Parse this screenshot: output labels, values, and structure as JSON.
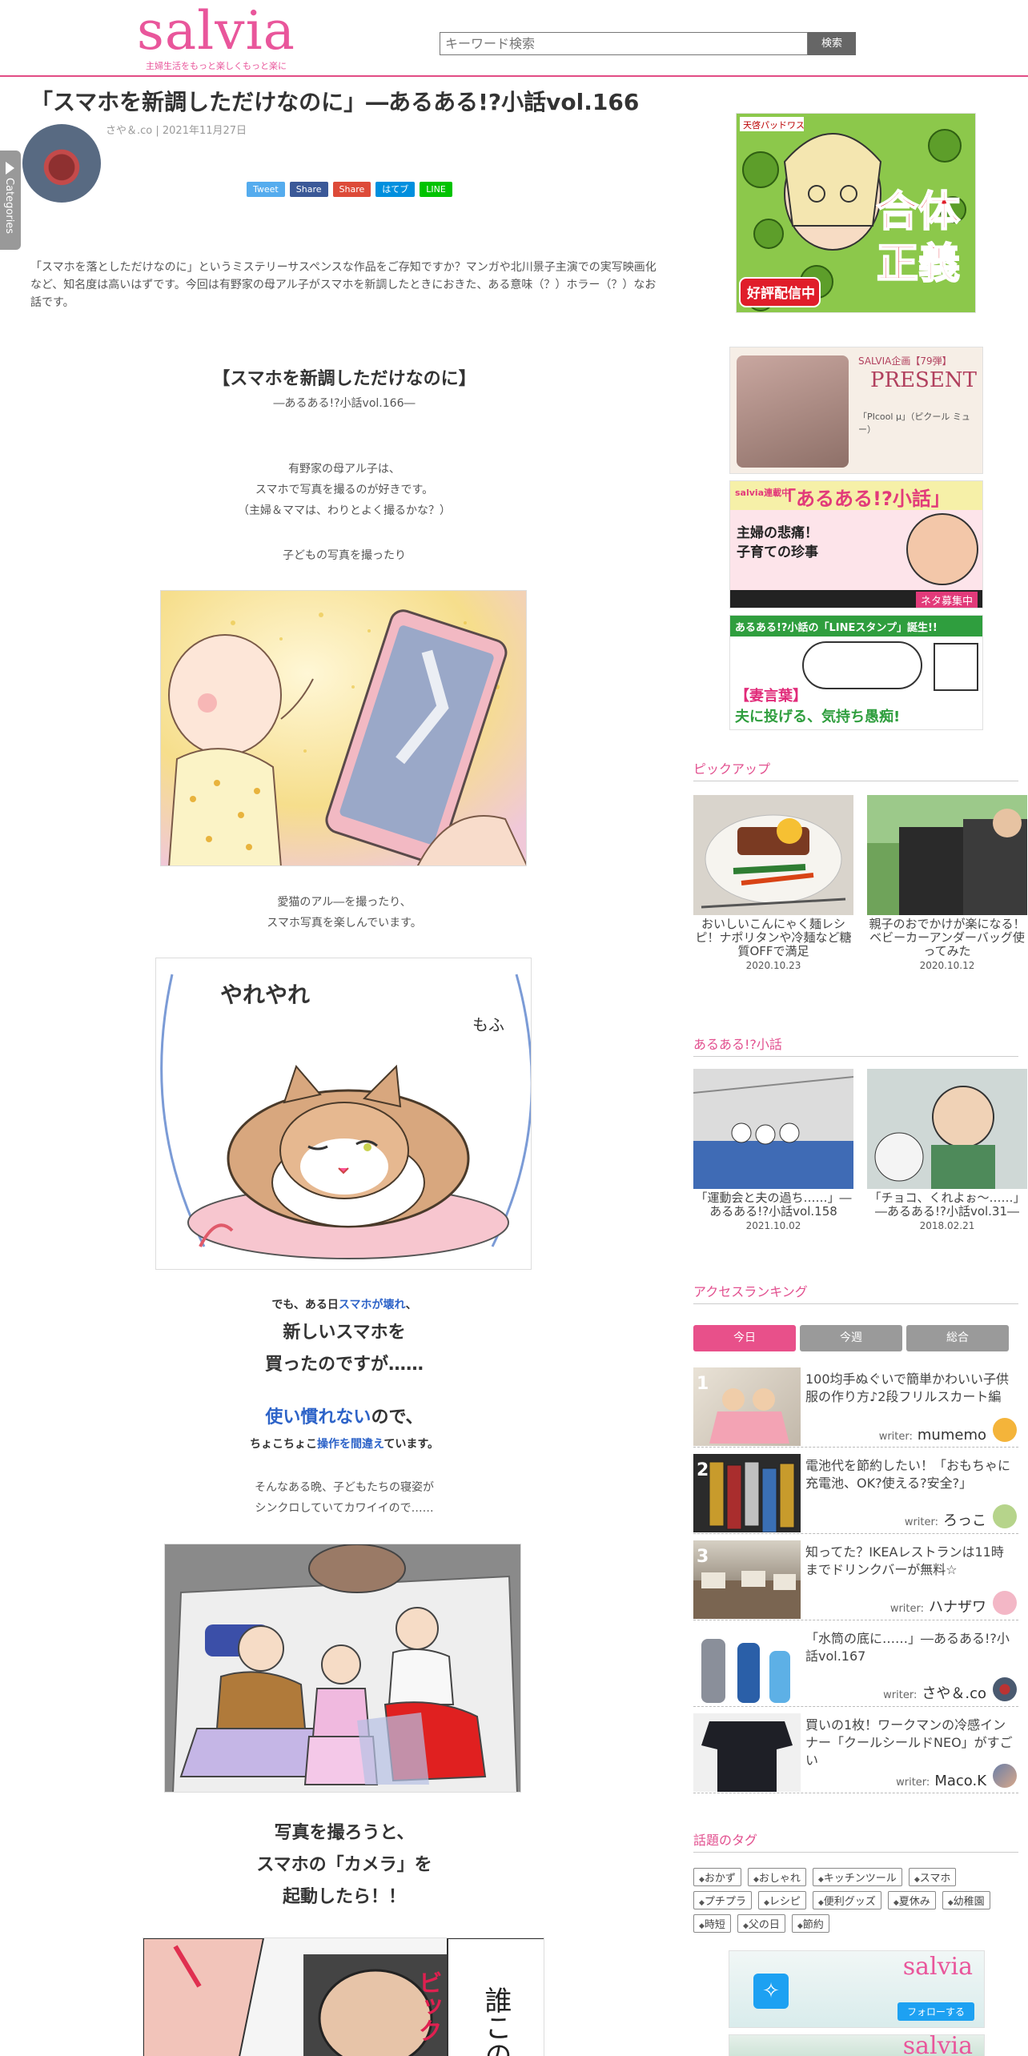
{
  "header": {
    "logo": "salvia",
    "tagline": "主婦生活をもっと楽しくもっと楽に",
    "search_placeholder": "キーワード検索",
    "search_button": "検索"
  },
  "categories_tab": "Categories",
  "article": {
    "title": "「スマホを新調しただけなのに」―あるある!?小話vol.166",
    "meta": "さや＆.co | 2021年11月27日",
    "share": [
      "Tweet",
      "Share",
      "Share",
      "はてブ",
      "LINE"
    ],
    "intro": "「スマホを落としただけなのに」というミステリーサスペンスな作品をご存知ですか？マンガや北川景子主演での実写映画化など、知名度は高いはずです。今回は有野家の母アル子がスマホを新調したときにおきた、ある意味（？）ホラー（？）なお話です。",
    "section_title": "【スマホを新調しただけなのに】",
    "section_sub": "―あるある!?小話vol.166―",
    "p1": [
      "有野家の母アル子は、",
      "スマホで写真を撮るのが好きです。",
      "（主婦＆ママは、わりとよく撮るかな？）"
    ],
    "p2": "子どもの写真を撮ったり",
    "p3": [
      "愛猫のアル―を撮ったり、",
      "スマホ写真を楽しんでいます。"
    ],
    "p4_pre": "でも、ある日",
    "p4_hl": "スマホが壊れ",
    "p4_post": "、",
    "p5": [
      "新しいスマホを",
      "買ったのですが……"
    ],
    "p6_hl": "使い慣れない",
    "p6_post": "ので、",
    "p7_pre": "ちょこちょこ",
    "p7_hl": "操作を間違え",
    "p7_post": "ています。",
    "p8": [
      "そんなある晩、子どもたちの寝姿が",
      "シンクロしていてカワイイので……"
    ],
    "p9": [
      "写真を撮ろうと、",
      "スマホの「カメラ」を",
      "起動したら！！"
    ],
    "comic_text_cat": "やれやれ",
    "comic_text_cat2": "もふ",
    "comic_text_last": "誰この",
    "comic_text_last2": "ビック"
  },
  "sidebar": {
    "ad_game": {
      "title": "天啓パッドワス",
      "text1": "合体",
      "text2": "正義",
      "badge": "好評配信中"
    },
    "banner_present": {
      "label": "SALVIA企画【79弾】",
      "title": "PRESENT",
      "text": "「PIcool μ」（ピクール ミュー）"
    },
    "banner_aruaru": {
      "label": "salvia連載中",
      "title": "「あるある!?小話」",
      "text1": "主婦の悲痛！",
      "text2": "子育ての珍事",
      "badge": "ネタ募集中"
    },
    "banner_line": {
      "title": "あるある!?小話の「LINEスタンプ」誕生!!",
      "text1": "【妻言葉】",
      "text2": "夫に投げる、気持ち愚痴!"
    },
    "pickup_title": "ピックアップ",
    "pickup": [
      {
        "title": "おいしいこんにゃく麺レシピ！ナポリタンや冷麺など糖質OFFで満足",
        "date": "2020.10.23"
      },
      {
        "title": "親子のおでかけが楽になる！ベビーカーアンダーバッグ使ってみた",
        "date": "2020.10.12"
      }
    ],
    "aruaru_title": "あるある!?小話",
    "aruaru": [
      {
        "title": "「運動会と夫の過ち……」―あるある!?小話vol.158",
        "date": "2021.10.02"
      },
      {
        "title": "「チョコ、くれよぉ～……」―あるある!?小話vol.31―",
        "date": "2018.02.21"
      }
    ],
    "ranking_title": "アクセスランキング",
    "ranking_tabs": [
      "今日",
      "今週",
      "総合"
    ],
    "ranking": [
      {
        "num": "1",
        "title": "100均手ぬぐいで簡単かわいい子供服の作り方♪2段フリルスカート編",
        "writer_label": "writer:",
        "writer": "mumemo"
      },
      {
        "num": "2",
        "title": "電池代を節約したい！「おもちゃに充電池、OK?使える?安全?」",
        "writer_label": "writer:",
        "writer": "ろっこ"
      },
      {
        "num": "3",
        "title": "知ってた？IKEAレストランは11時までドリンクバーが無料☆",
        "writer_label": "writer:",
        "writer": "ハナザワ"
      },
      {
        "num": "4",
        "title": "「水筒の底に……」―あるある!?小話vol.167",
        "writer_label": "writer:",
        "writer": "さや＆.co"
      },
      {
        "num": "5",
        "title": "買いの1枚！ワークマンの冷感インナー「クールシールドNEO」がすごい",
        "writer_label": "writer:",
        "writer": "Maco.K"
      }
    ],
    "tags_title": "話題のタグ",
    "tags": [
      "おかず",
      "おしゃれ",
      "キッチンツール",
      "スマホ",
      "プチプラ",
      "レシピ",
      "便利グッズ",
      "夏休み",
      "幼稚園",
      "時短",
      "父の日",
      "節約"
    ],
    "twitter": {
      "logo": "salvia",
      "follow": "フォローする"
    }
  },
  "colors": {
    "accent": "#e8508a",
    "link_blue": "#2d63c8",
    "twitter": "#1da1f2"
  }
}
